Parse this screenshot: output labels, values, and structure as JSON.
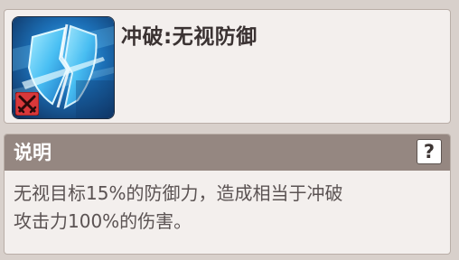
{
  "skill": {
    "icon": "shield-break-icon",
    "badge_icon": "crossed-swords-icon",
    "name": "冲破:无视防御"
  },
  "description": {
    "header": "说明",
    "help_label": "?",
    "lines": [
      "无视目标15%的防御力，造成相当于冲破",
      "攻击力100%的伤害。"
    ]
  },
  "colors": {
    "background": "#d8d0cb",
    "panel": "#f3efed",
    "header_bar": "#958781",
    "icon_blue": "#2aa7e6",
    "badge_red": "#d8383a"
  }
}
